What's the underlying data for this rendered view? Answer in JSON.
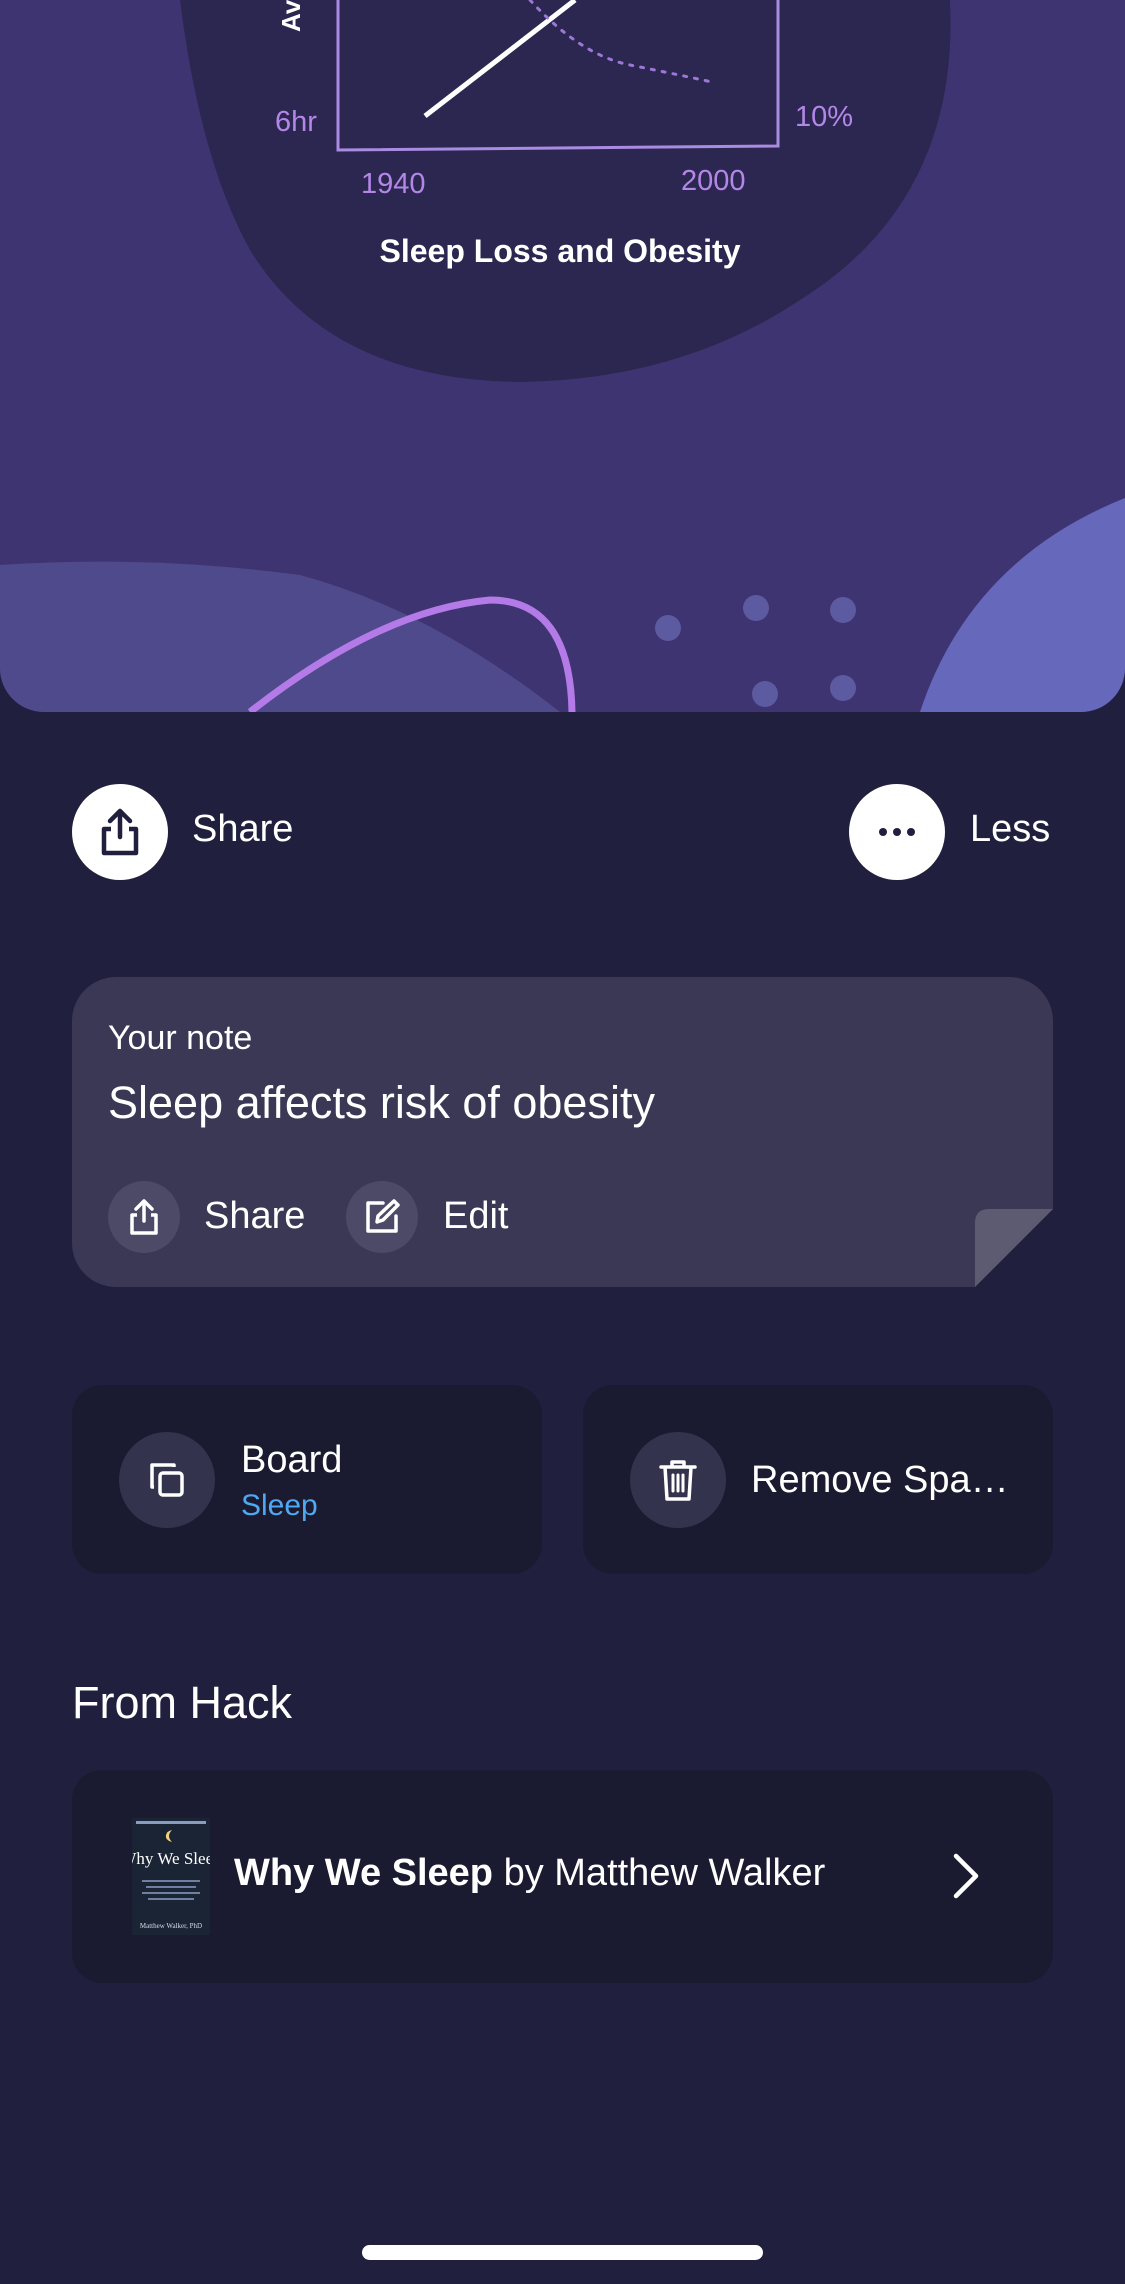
{
  "hero": {
    "y_axis_title": "Av",
    "y_tick_left": "6hr",
    "y_tick_right": "10%",
    "x_tick_start": "1940",
    "x_tick_end": "2000",
    "caption": "Sleep Loss and Obesity"
  },
  "actions": {
    "share_label": "Share",
    "less_label": "Less"
  },
  "note": {
    "caption": "Your note",
    "text": "Sleep affects risk of obesity",
    "share_label": "Share",
    "edit_label": "Edit"
  },
  "tiles": {
    "board_label": "Board",
    "board_value": "Sleep",
    "remove_label": "Remove Spa…"
  },
  "from_section": {
    "title": "From Hack"
  },
  "book": {
    "title": "Why We Sleep",
    "by": " by Matthew Walker",
    "cover_title": "Why We Sleep",
    "cover_author": "Matthew Walker, PhD"
  },
  "colors": {
    "background": "#201f3e",
    "hero_background": "#3f3472",
    "hero_blob": "#2c2750",
    "accent_purple": "#b486e8",
    "link_blue": "#4ea8f2"
  }
}
